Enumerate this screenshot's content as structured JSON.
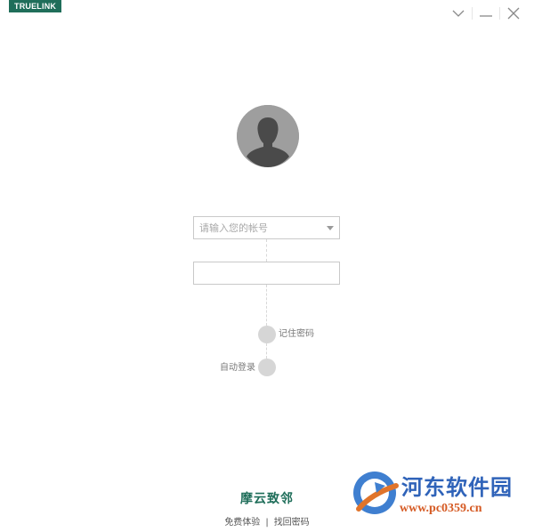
{
  "window": {
    "brand": "TRUELINK"
  },
  "login": {
    "account_placeholder": "请输入您的帐号",
    "password_value": "",
    "remember_label": "记住密码",
    "autologin_label": "自动登录"
  },
  "footer": {
    "product_name": "摩云致邻",
    "free_trial": "免费体验",
    "separator": "|",
    "recover_password": "找回密码"
  },
  "watermark": {
    "title": "河东软件园",
    "url": "www.pc0359.cn"
  },
  "colors": {
    "brand": "#1f6e5a",
    "watermark_blue": "#2f63b9",
    "watermark_orange": "#d55a23"
  }
}
